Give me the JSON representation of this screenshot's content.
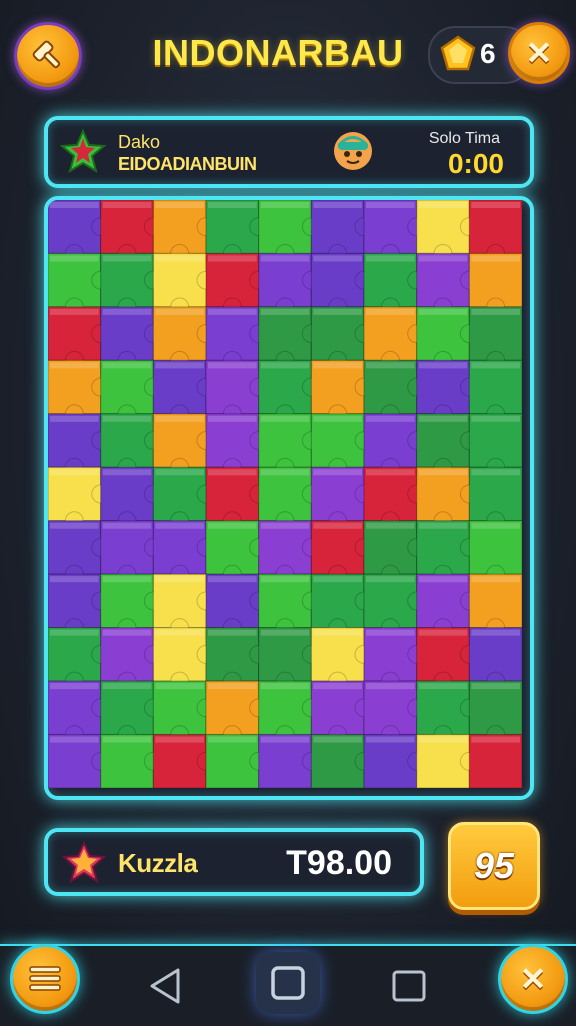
{
  "header": {
    "title": "INDONARBAU",
    "back_icon": "hammer-icon",
    "gem_count": "6",
    "close_icon": "close-icon"
  },
  "info": {
    "player_line1": "Dako",
    "player_line2": "EIDOADIANBUIN",
    "timer_label": "Solo Tima",
    "timer_value": "0:00"
  },
  "board": {
    "columns": 9,
    "rows": 11,
    "piece_colors": [
      "#7a3fd1",
      "#f3a021",
      "#2aa84a",
      "#3ec33e",
      "#6a3dc8",
      "#d8243b",
      "#8a3fd2",
      "#f7e04c",
      "#2f9a45"
    ]
  },
  "score": {
    "label": "Kuzzla",
    "value": "T98.00",
    "badge": "95"
  },
  "nav": {
    "menu_icon": "list-icon",
    "back_icon": "triangle-back-icon",
    "home_icon": "square-home-icon",
    "recent_icon": "recent-apps-icon",
    "close_icon": "close-icon"
  },
  "colors": {
    "accent_cyan": "#4de6f2",
    "title_yellow": "#ffe84a",
    "button_orange": "#f39b12"
  }
}
